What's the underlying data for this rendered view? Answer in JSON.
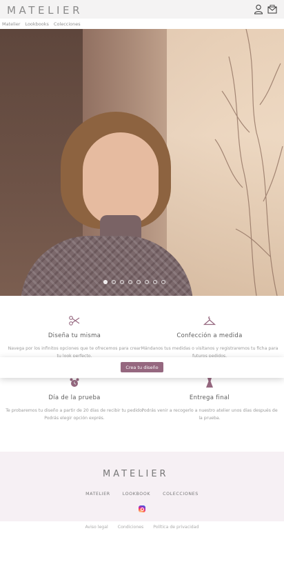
{
  "header": {
    "logo": "MATELIER",
    "icons": [
      "user-icon",
      "mail-icon"
    ]
  },
  "subnav": {
    "items": [
      "Matelier",
      "Lookbooks",
      "Colecciones"
    ]
  },
  "hero": {
    "slides_total": 8,
    "active_slide": 1
  },
  "features": [
    {
      "icon": "scissors-icon",
      "title": "Diseña tu misma",
      "text": "Navega por los infinitos opciones que te ofrecemos para crear tu look perfecto."
    },
    {
      "icon": "hanger-icon",
      "title": "Confección a medida",
      "text": "Mándanos tus medidas o visítanos y registraremos tu ficha para futuros pedidos."
    },
    {
      "icon": "alarm-clock-icon",
      "title": "Día de la prueba",
      "text": "Te probaremos tu diseño a partir de 20 días de recibir tu pedido. Podrás elegir opción exprés."
    },
    {
      "icon": "dress-icon",
      "title": "Entrega final",
      "text": "Podrás venir a recogerlo a nuestro atelier unos días después de la prueba."
    }
  ],
  "cta": {
    "label": "Crea tu diseño"
  },
  "footer": {
    "logo": "MATELIER",
    "nav": [
      "MATELIER",
      "LOOKBOOK",
      "COLECCIONES"
    ],
    "social": "instagram-icon",
    "legal": [
      "Aviso legal",
      "Condiciones",
      "Política de privacidad"
    ]
  },
  "colors": {
    "accent": "#95677f",
    "footer_bg": "#f6f0f4"
  }
}
